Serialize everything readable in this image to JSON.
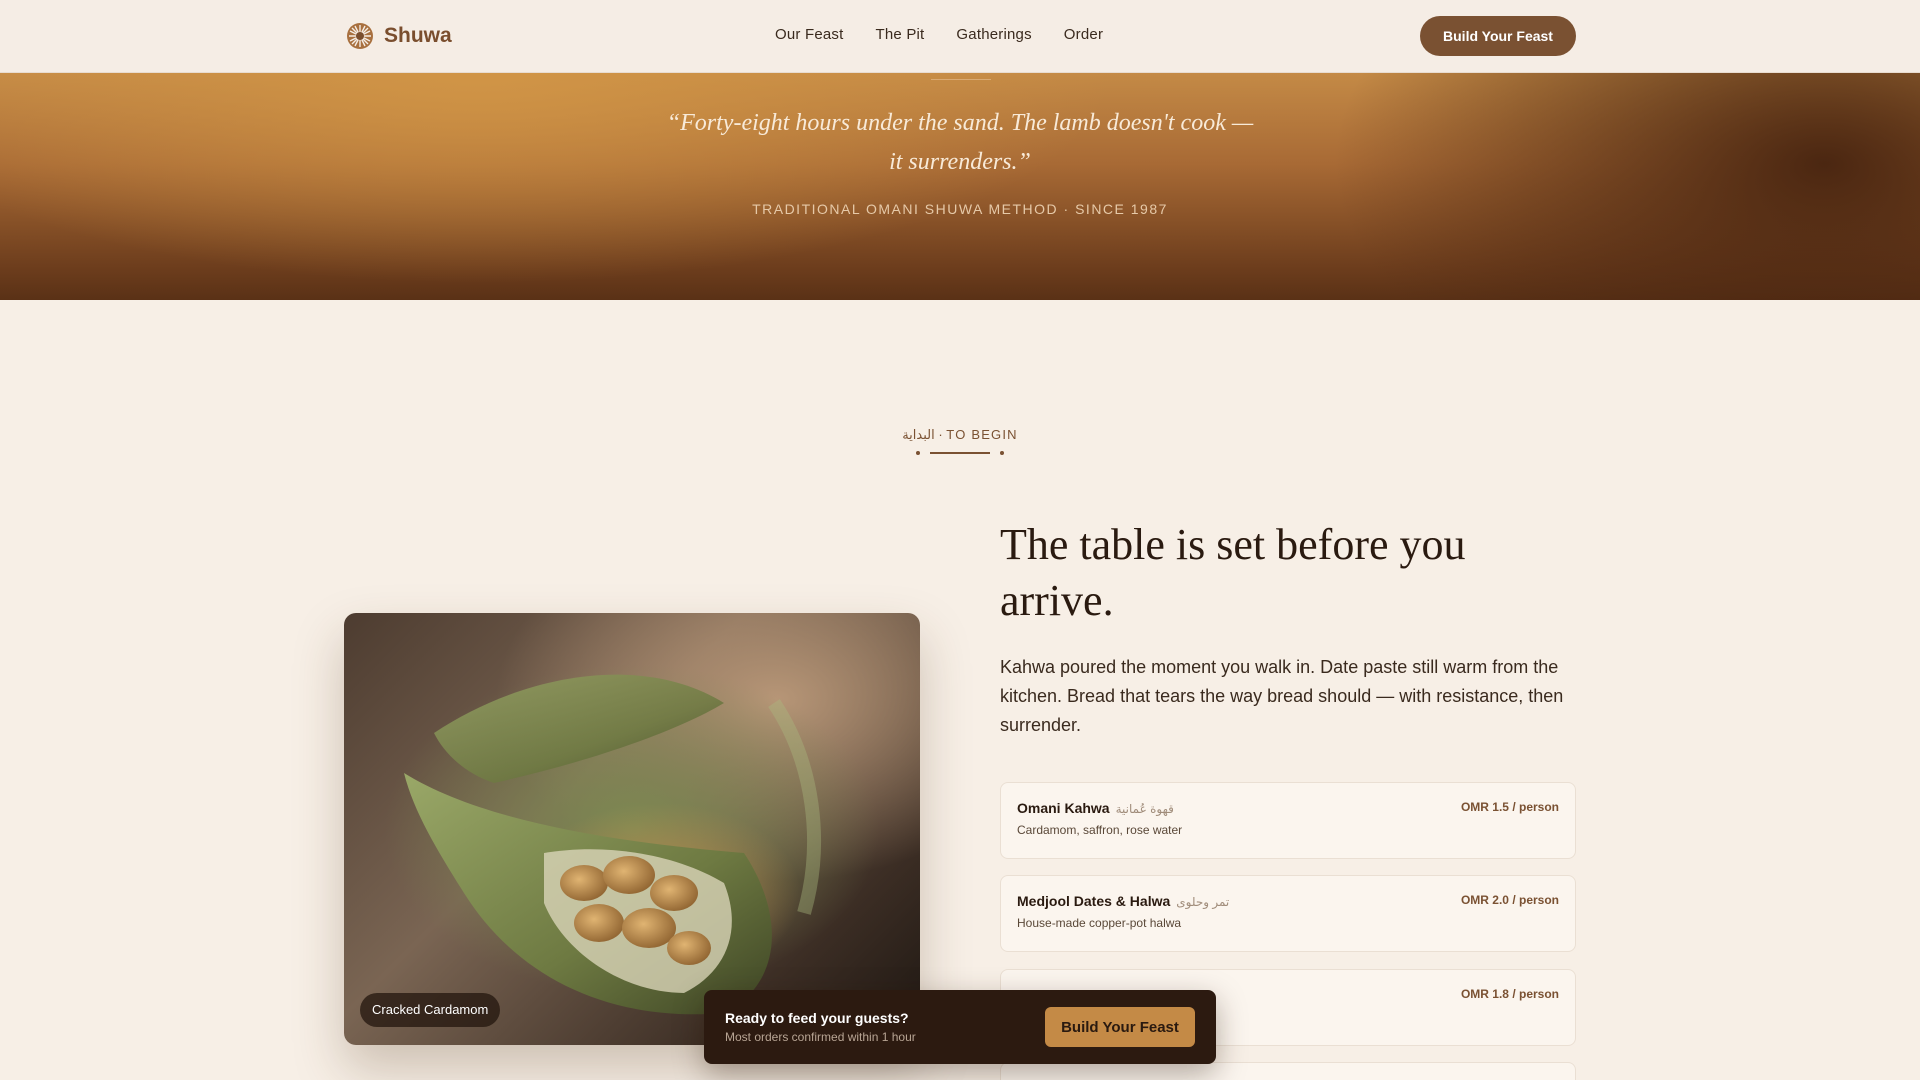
{
  "nav": {
    "brand": "Shuwa",
    "links": [
      "Our Feast",
      "The Pit",
      "Gatherings",
      "Order"
    ],
    "cta": "Build Your Feast"
  },
  "hero": {
    "quote": "“Forty-eight hours under the sand. The lamb doesn't cook — it surrenders.”",
    "sub": "TRADITIONAL OMANI SHUWA METHOD · SINCE 1987"
  },
  "section": {
    "label": "البداية · TO BEGIN",
    "title": "The table is set before you arrive.",
    "body": "Kahwa poured the moment you walk in. Date paste still warm from the kitchen. Bread that tears the way bread should — with resistance, then surrender."
  },
  "photo": {
    "caption": "Cracked Cardamom"
  },
  "menu": [
    {
      "name": "Omani Kahwa",
      "arabic": "قهوة عُمانية",
      "desc": "Cardamom, saffron, rose water",
      "price": "OMR 1.5 / person"
    },
    {
      "name": "Medjool Dates & Halwa",
      "arabic": "تمر وحلوى",
      "desc": "House-made copper-pot halwa",
      "price": "OMR 2.0 / person"
    },
    {
      "name": "",
      "arabic": "",
      "desc": "",
      "price": "OMR 1.8 / person"
    }
  ],
  "sticky": {
    "title": "Ready to feed your guests?",
    "sub": "Most orders confirmed within 1 hour",
    "cta": "Build Your Feast"
  },
  "colors": {
    "accent": "#7a5132",
    "gold": "#c48a46",
    "background": "#f7efe6",
    "dark": "#2c1a10"
  }
}
